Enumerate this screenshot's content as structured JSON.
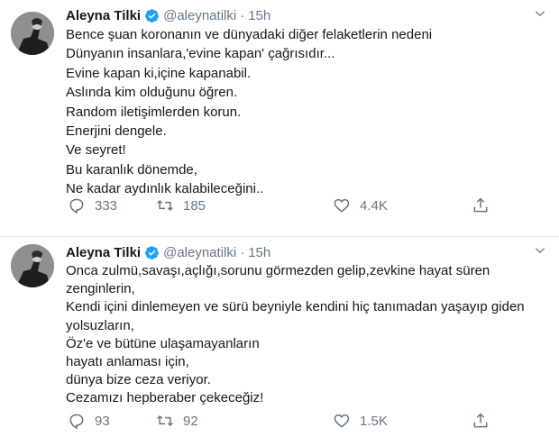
{
  "tweets": [
    {
      "author_name": "Aleyna Tilki",
      "handle": "@aleynatilki",
      "separator": "·",
      "time": "15h",
      "lines": [
        "Bence şuan koronanın ve dünyadaki diğer felaketlerin nedeni",
        "Dünyanın insanlara,'evine kapan' çağrısıdır...",
        "Evine kapan ki,içine kapanabil.",
        "Aslında kim olduğunu öğren.",
        "Random iletişimlerden korun.",
        "Enerjini dengele.",
        "Ve seyret!",
        "Bu karanlık dönemde,",
        "Ne kadar aydınlık kalabileceğini.."
      ],
      "replies": "333",
      "retweets": "185",
      "likes": "4.4K"
    },
    {
      "author_name": "Aleyna Tilki",
      "handle": "@aleynatilki",
      "separator": "·",
      "time": "15h",
      "lines": [
        "Onca zulmü,savaşı,açlığı,sorunu görmezden gelip,zevkine hayat süren",
        "zenginlerin,",
        "Kendi içini dinlemeyen ve sürü beyniyle kendini hiç tanımadan yaşayıp giden",
        "yolsuzların,",
        "Öz'e ve bütüne ulaşamayanların",
        "hayatı anlaması için,",
        "dünya bize ceza veriyor.",
        "Cezamızı hepberaber çekeceğiz!"
      ],
      "replies": "93",
      "retweets": "92",
      "likes": "1.5K"
    }
  ],
  "icons": {
    "verified": "verified-badge-icon",
    "caret": "chevron-down-icon",
    "reply": "reply-icon",
    "retweet": "retweet-icon",
    "like": "heart-icon",
    "share": "share-icon"
  },
  "colors": {
    "verified": "#1da1f2",
    "text": "#14171a",
    "muted": "#657786",
    "divider": "#e6ecf0"
  }
}
